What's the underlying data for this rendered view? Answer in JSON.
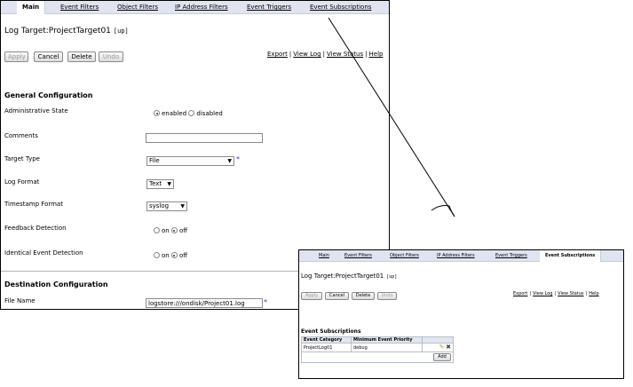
{
  "main_view": {
    "tabs": [
      "Main",
      "Event Filters",
      "Object Filters",
      "IP Address Filters",
      "Event Triggers",
      "Event Subscriptions"
    ],
    "active_tab": "Main",
    "title": "Log Target:ProjectTarget01",
    "up_link": "[up]",
    "buttons": {
      "apply": "Apply",
      "cancel": "Cancel",
      "delete": "Delete",
      "undo": "Undo"
    },
    "links": [
      "Export",
      "View Log",
      "View Status",
      "Help"
    ],
    "general": {
      "heading": "General Configuration",
      "admin_state": {
        "label": "Administrative State",
        "opt1": "enabled",
        "opt2": "disabled",
        "selected": "enabled"
      },
      "comments": {
        "label": "Comments",
        "value": ""
      },
      "target_type": {
        "label": "Target Type",
        "value": "File"
      },
      "log_format": {
        "label": "Log Format",
        "value": "Text"
      },
      "timestamp_format": {
        "label": "Timestamp Format",
        "value": "syslog"
      },
      "feedback_detection": {
        "label": "Feedback Detection",
        "opt1": "on",
        "opt2": "off",
        "selected": "off"
      },
      "identical_event_detection": {
        "label": "Identical Event Detection",
        "opt1": "on",
        "opt2": "off",
        "selected": "off"
      }
    },
    "destination": {
      "heading": "Destination Configuration",
      "file_name": {
        "label": "File Name",
        "value": "logstore:///ondisk/Project01.log"
      }
    },
    "required_marker": "*"
  },
  "subscriptions_view": {
    "tabs": [
      "Main",
      "Event Filters",
      "Object Filters",
      "IP Address Filters",
      "Event Triggers",
      "Event Subscriptions"
    ],
    "active_tab": "Event Subscriptions",
    "title": "Log Target:ProjectTarget01",
    "up_link": "[up]",
    "buttons": {
      "apply": "Apply",
      "cancel": "Cancel",
      "delete": "Delete",
      "undo": "Undo",
      "add": "Add"
    },
    "links": [
      "Export",
      "View Log",
      "View Status",
      "Help"
    ],
    "section_heading": "Event Subscriptions",
    "table": {
      "headers": [
        "Event Category",
        "Minimum Event Priority"
      ],
      "rows": [
        {
          "category": "ProjectLog01",
          "priority": "debug"
        }
      ]
    }
  },
  "icons": [
    "edit-pencil-icon",
    "delete-x-icon",
    "radio-icon",
    "dropdown-caret-icon"
  ],
  "colors": {
    "tab_bar": "#dfe4f0",
    "required_star": "#3a3aa0",
    "table_header": "#e2e6ee"
  }
}
